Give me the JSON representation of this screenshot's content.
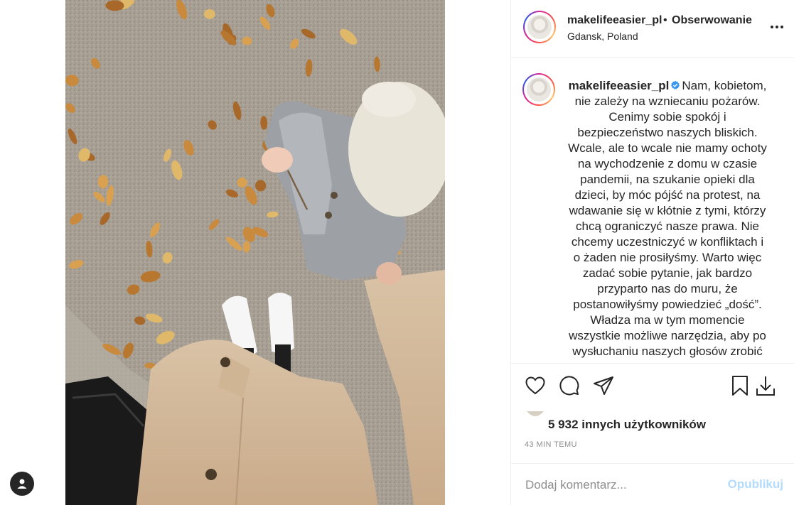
{
  "post": {
    "username": "makelifeeasier_pl",
    "separator": "•",
    "follow_label": "Obserwowanie",
    "location": "Gdansk, Poland"
  },
  "caption": {
    "username": "makelifeeasier_pl",
    "text": "Nam, kobietom, nie zależy na wzniecaniu pożarów. Cenimy sobie spokój i bezpieczeństwo naszych bliskich. Wcale, ale to wcale nie mamy ochoty na wychodzenie z domu w czasie pandemii, na szukanie opieki dla dzieci, by móc pójść na protest, na wdawanie się w kłótnie z tymi, którzy chcą ograniczyć nasze prawa. Nie chcemy uczestniczyć w konfliktach i o żaden nie prosiłyśmy. Warto więc zadać sobie pytanie, jak bardzo przyparto nas do muru, że postanowiłyśmy powiedzieć „dość”. Władza ma w tym momencie wszystkie możliwe narzędzia, aby po wysłuchaniu naszych głosów zrobić"
  },
  "likes": {
    "text": "5 932 innych użytkowników"
  },
  "timestamp": "43 MIN TEMU",
  "comment": {
    "placeholder": "Dodaj komentarz...",
    "publish_label": "Opublikuj"
  },
  "icons": {
    "like": "heart-icon",
    "comment": "comment-icon",
    "share": "paper-plane-icon",
    "save": "bookmark-icon",
    "download": "download-icon",
    "more": "ellipsis-icon",
    "verified": "verified-badge-icon",
    "user": "user-icon"
  },
  "colors": {
    "text": "#262626",
    "muted": "#8e8e8e",
    "verified": "#3897f0",
    "publish_disabled": "#b3dbff",
    "border": "#efefef"
  }
}
